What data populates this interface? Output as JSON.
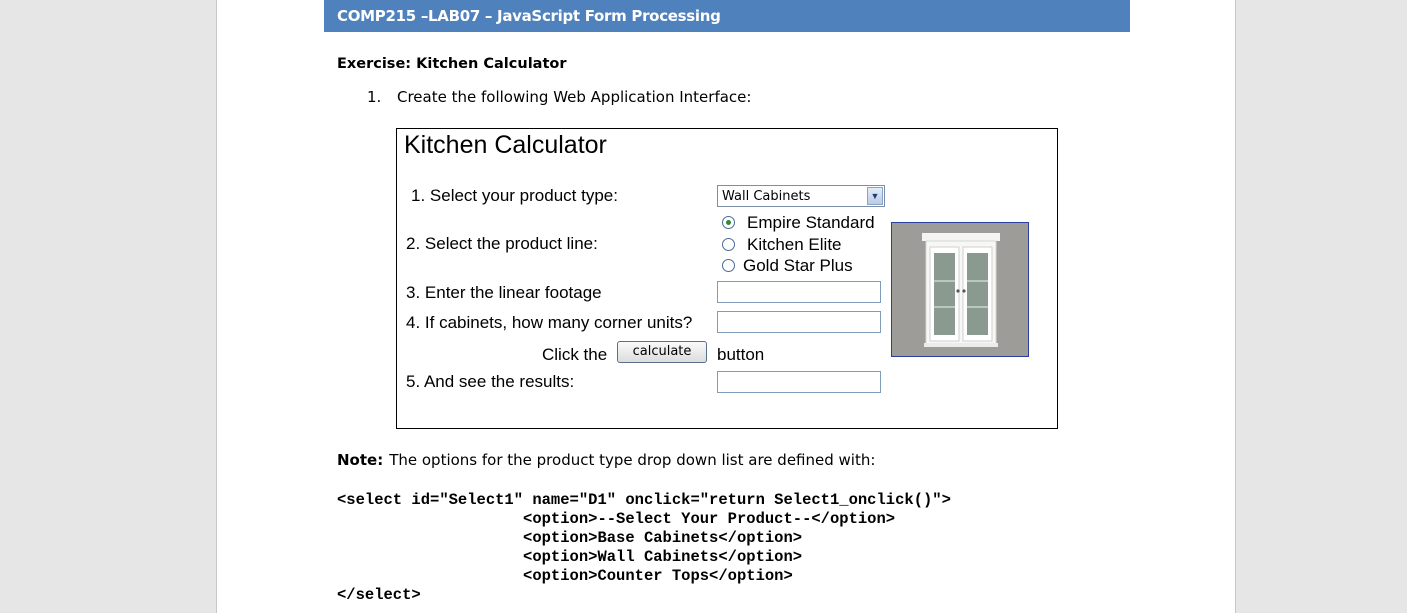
{
  "header": {
    "title": "COMP215 –LAB07 – JavaScript Form Processing"
  },
  "exercise": {
    "heading": "Exercise: Kitchen Calculator"
  },
  "step": {
    "number": "1.",
    "text": "Create the following Web Application Interface:"
  },
  "calculator": {
    "title": "Kitchen Calculator",
    "label_product_type": "1. Select your product type:",
    "label_product_line": "2. Select the product line:",
    "label_linear_footage": "3. Enter the linear footage",
    "label_corner_units": "4. If cabinets, how many corner units?",
    "label_results": "5. And see the results:",
    "product_type_selected": "Wall Cabinets",
    "product_lines": [
      {
        "label": "Empire Standard",
        "checked": true
      },
      {
        "label": "Kitchen Elite",
        "checked": false
      },
      {
        "label": "Gold Star Plus",
        "checked": false
      }
    ],
    "click_the": "Click the",
    "calculate_button": "calculate",
    "button_word": "button",
    "linear_footage_value": "",
    "corner_units_value": "",
    "results_value": ""
  },
  "note": {
    "label": "Note:",
    "text": "The options for the product type drop down list are defined with:"
  },
  "code_lines": [
    "<select id=\"Select1\" name=\"D1\" onclick=\"return Select1_onclick()\">",
    "                    <option>--Select Your Product--</option>",
    "                    <option>Base Cabinets</option>",
    "                    <option>Wall Cabinets</option>",
    "                    <option>Counter Tops</option>",
    "</select>"
  ],
  "colors": {
    "header_bar": "#4f81bd",
    "page_bg": "#e6e6e6"
  },
  "icons": {
    "dropdown_arrow": "chevron-down-icon",
    "product_image": "wall-cabinet-image"
  }
}
